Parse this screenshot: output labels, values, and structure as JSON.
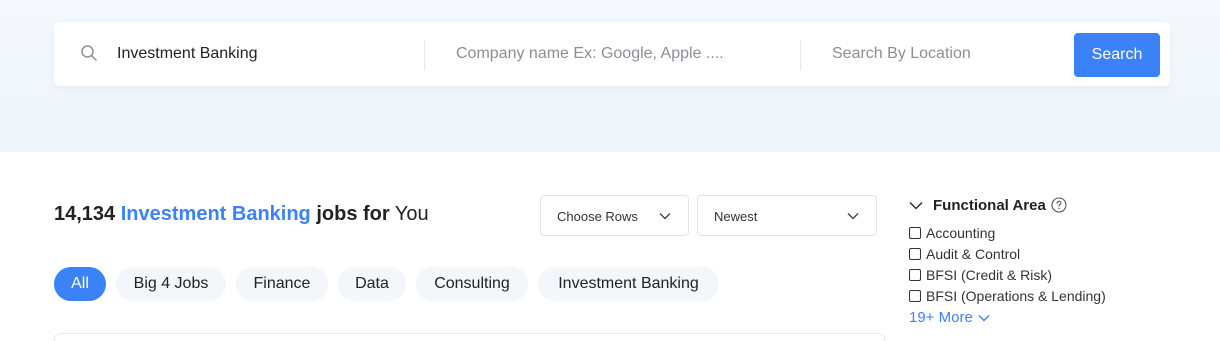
{
  "search": {
    "keyword_value": "Investment Banking",
    "company_placeholder": "Company name Ex: Google, Apple ....",
    "location_placeholder": "Search By Location",
    "button_label": "Search"
  },
  "results": {
    "count": "14,134",
    "keyword": "Investment Banking",
    "middle": "jobs for",
    "suffix": "You"
  },
  "filters": {
    "rows_label": "Choose Rows",
    "sort_label": "Newest"
  },
  "chips": [
    {
      "label": "All",
      "active": true
    },
    {
      "label": "Big 4 Jobs",
      "active": false
    },
    {
      "label": "Finance",
      "active": false
    },
    {
      "label": "Data",
      "active": false
    },
    {
      "label": "Consulting",
      "active": false
    },
    {
      "label": "Investment Banking",
      "active": false
    }
  ],
  "functional_area": {
    "title": "Functional Area",
    "items": [
      {
        "label": "Accounting",
        "checked": false
      },
      {
        "label": "Audit & Control",
        "checked": false
      },
      {
        "label": "BFSI (Credit & Risk)",
        "checked": false
      },
      {
        "label": "BFSI (Operations & Lending)",
        "checked": false
      }
    ],
    "more_label": "19+ More"
  },
  "colors": {
    "accent": "#3b82f6",
    "chip_bg": "#f3f7fc",
    "hero_bg": "#eef5fb"
  }
}
